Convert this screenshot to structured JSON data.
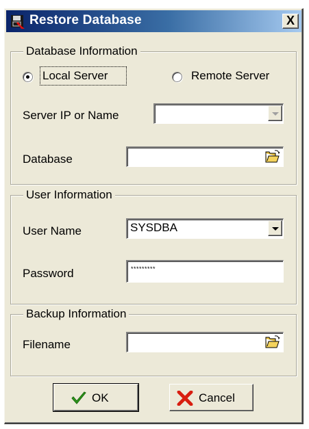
{
  "window": {
    "title": "Restore Database",
    "close_glyph": "X",
    "icon": "database-restore-icon"
  },
  "database_info": {
    "legend": "Database Information",
    "local_server_label": "Local Server",
    "remote_server_label": "Remote Server",
    "selected_server": "Local Server",
    "server_ip_label": "Server IP or Name",
    "server_ip_value": "",
    "database_label": "Database",
    "database_value": ""
  },
  "user_info": {
    "legend": "User Information",
    "username_label": "User Name",
    "username_value": "SYSDBA",
    "password_label": "Password",
    "password_masked": "*********"
  },
  "backup_info": {
    "legend": "Backup Information",
    "filename_label": "Filename",
    "filename_value": ""
  },
  "buttons": {
    "ok_label": "OK",
    "cancel_label": "Cancel"
  },
  "colors": {
    "title_bar_start": "#0a246a",
    "title_bar_end": "#a6caf0",
    "dialog_face": "#ece9d8",
    "ok_check": "#2e9b1c",
    "cancel_x": "#d81e10"
  }
}
